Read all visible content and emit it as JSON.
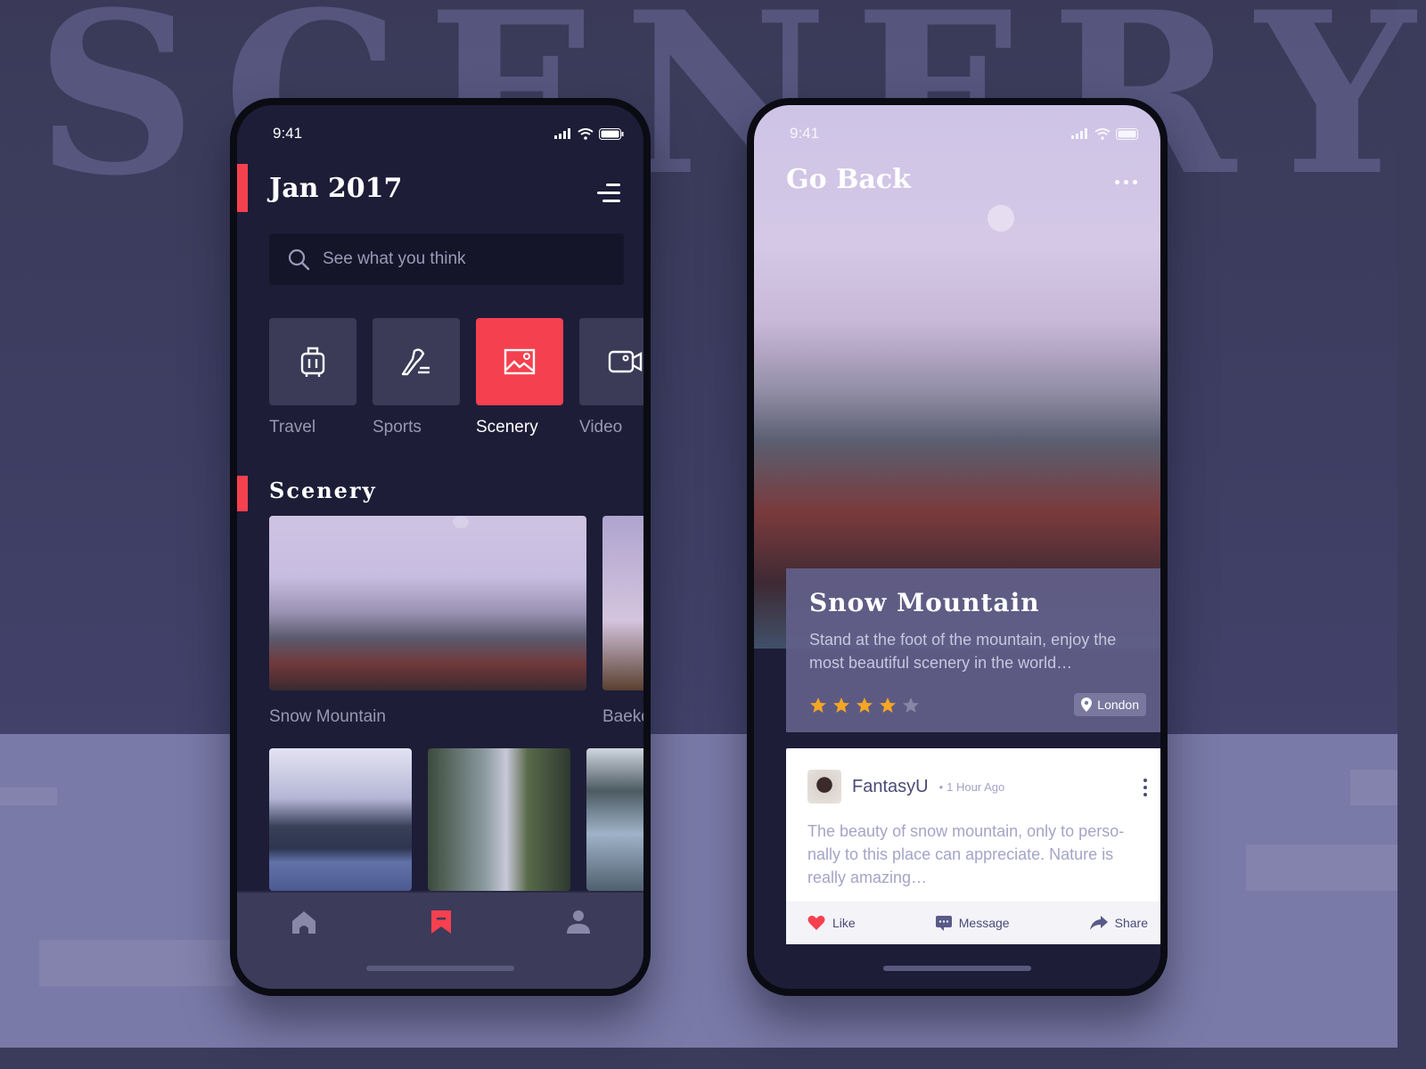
{
  "background": {
    "watermark": "SCENERY",
    "accent_color": "#f5404f"
  },
  "left_phone": {
    "status": {
      "time": "9:41"
    },
    "header": {
      "title": "Jan 2017",
      "menu_icon": "menu-icon"
    },
    "search": {
      "placeholder": "See what you think",
      "value": ""
    },
    "categories": [
      {
        "label": "Travel",
        "icon": "luggage-icon",
        "active": false
      },
      {
        "label": "Sports",
        "icon": "sneaker-icon",
        "active": false
      },
      {
        "label": "Scenery",
        "icon": "image-icon",
        "active": true
      },
      {
        "label": "Video",
        "icon": "video-camera-icon",
        "active": false
      }
    ],
    "section_title": "Scenery",
    "featured": [
      {
        "caption": "Snow Mountain"
      },
      {
        "caption": "Baekd"
      }
    ],
    "thumbnails": [
      "Snowy lake cabin",
      "Snowy forest road",
      "Snowy hillside"
    ],
    "tabbar": [
      {
        "name": "home",
        "icon": "home-icon",
        "active": false
      },
      {
        "name": "bookmark",
        "icon": "bookmark-icon",
        "active": true
      },
      {
        "name": "profile",
        "icon": "user-icon",
        "active": false
      }
    ]
  },
  "right_phone": {
    "status": {
      "time": "9:41"
    },
    "header": {
      "back_label": "Go Back",
      "more_icon": "more-icon"
    },
    "place": {
      "title": "Snow Mountain",
      "description": "Stand at the foot of the mountain, enjoy the most beautiful scenery in the world…",
      "rating": 4,
      "rating_max": 5,
      "location": "London"
    },
    "comment": {
      "user": "FantasyU",
      "time": "1 Hour Ago",
      "text": "The beauty of snow mountain, only to perso-nally to this place can appreciate. Nature is really amazing…",
      "actions": {
        "like": "Like",
        "message": "Message",
        "share": "Share"
      }
    }
  }
}
